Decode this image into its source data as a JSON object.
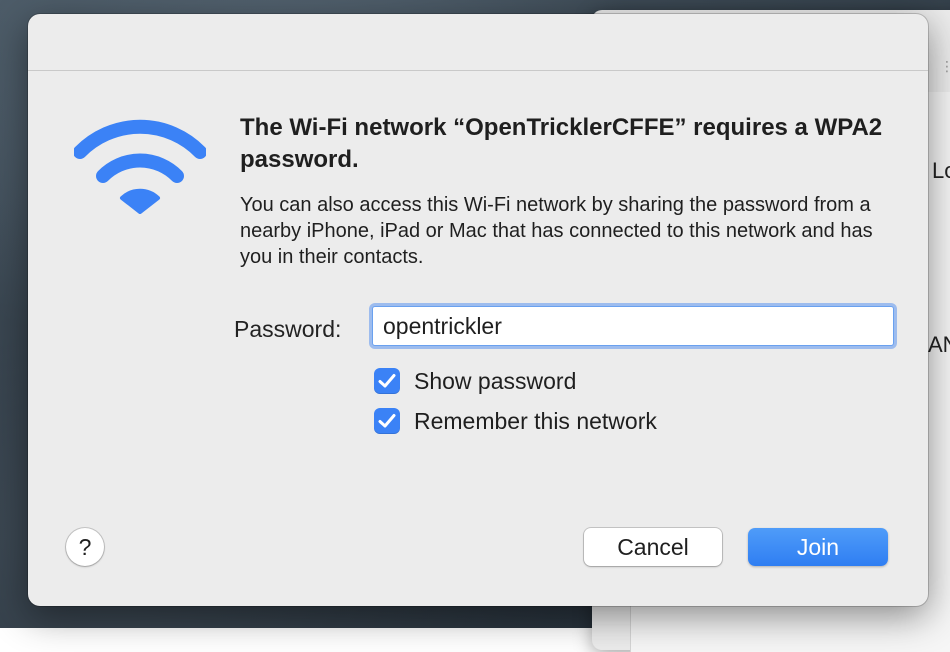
{
  "dialog": {
    "title": "The Wi-Fi network “OpenTricklerCFFE” requires a WPA2 password.",
    "description": "You can also access this Wi-Fi network by sharing the password from a nearby iPhone, iPad or Mac that has connected to this network and has you in their contacts.",
    "icon": "wifi-icon",
    "accent_color": "#3b82f6",
    "password_label": "Password:",
    "password_value": "opentrickler",
    "show_password": {
      "label": "Show password",
      "checked": true
    },
    "remember_network": {
      "label": "Remember this network",
      "checked": true
    },
    "help_label": "?",
    "cancel_label": "Cancel",
    "join_label": "Join"
  },
  "background_window": {
    "fragment_1": "Lo",
    "fragment_2": "AN"
  }
}
